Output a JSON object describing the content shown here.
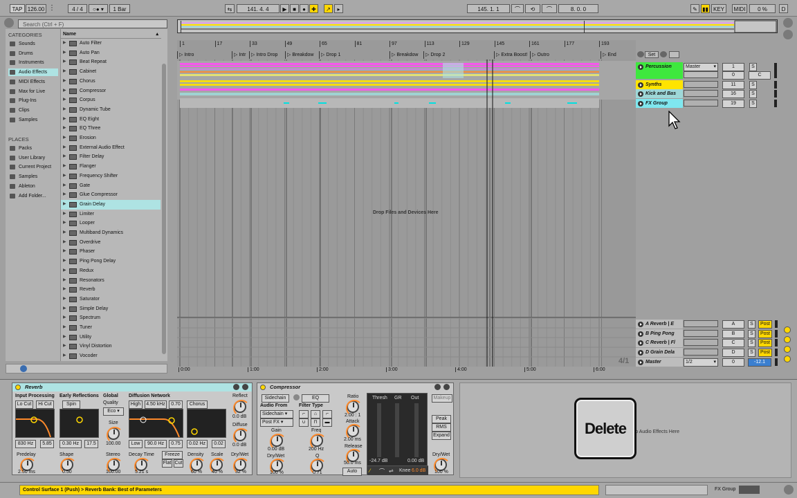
{
  "transport": {
    "tap": "TAP",
    "tempo": "126.00",
    "sig_num": "4",
    "sig_den": "4",
    "quantize": "1 Bar",
    "position": "141.  4.  4",
    "loop_start": "145.  1.  1",
    "loop_length": "8.  0.  0",
    "key_label": "KEY",
    "midi_label": "MIDI",
    "cpu": "0 %",
    "d_label": "D"
  },
  "browser": {
    "search_placeholder": "Search (Ctrl + F)",
    "categories_title": "CATEGORIES",
    "categories": [
      "Sounds",
      "Drums",
      "Instruments",
      "Audio Effects",
      "MIDI Effects",
      "Max for Live",
      "Plug-Ins",
      "Clips",
      "Samples"
    ],
    "selected_category": "Audio Effects",
    "places_title": "PLACES",
    "places": [
      "Packs",
      "User Library",
      "Current Project",
      "Samples",
      "Ableton",
      "Add Folder..."
    ],
    "name_header": "Name",
    "items": [
      "Auto Filter",
      "Auto Pan",
      "Beat Repeat",
      "Cabinet",
      "Chorus",
      "Compressor",
      "Corpus",
      "Dynamic Tube",
      "EQ Eight",
      "EQ Three",
      "Erosion",
      "External Audio Effect",
      "Filter Delay",
      "Flanger",
      "Frequency Shifter",
      "Gate",
      "Glue Compressor",
      "Grain Delay",
      "Limiter",
      "Looper",
      "Multiband Dynamics",
      "Overdrive",
      "Phaser",
      "Ping Pong Delay",
      "Redux",
      "Resonators",
      "Reverb",
      "Saturator",
      "Simple Delay",
      "Spectrum",
      "Tuner",
      "Utility",
      "Vinyl Distortion",
      "Vocoder"
    ],
    "selected_item": "Grain Delay"
  },
  "arrangement": {
    "bar_numbers": [
      "1",
      "17",
      "33",
      "49",
      "65",
      "81",
      "97",
      "113",
      "129",
      "145",
      "161",
      "177",
      "193"
    ],
    "locators": [
      "Intro",
      "Intr",
      "Intro Drop",
      "Breakdow",
      "Drop 1",
      "Breakdow",
      "Drop 2",
      "Extra Boost!",
      "Outro",
      "End"
    ],
    "time_labels": [
      "0:00",
      "1:00",
      "2:00",
      "3:00",
      "4:00",
      "5:00",
      "6:00"
    ],
    "drop_text": "Drop Files and Devices Here",
    "zoom_label": "4/1",
    "set_label": "Set"
  },
  "tracks": [
    {
      "name": "Percussion",
      "color": "#3ee83e",
      "routing": "Master",
      "number": "1",
      "value": "0",
      "solo": "S",
      "center": "C"
    },
    {
      "name": "Synths",
      "color": "#ffe400",
      "number": "11",
      "solo": "S"
    },
    {
      "name": "Kick and Bas",
      "color": "#9ed8d8",
      "number": "16",
      "solo": "S"
    },
    {
      "name": "FX Group",
      "color": "#7fe7ef",
      "number": "19",
      "solo": "S"
    }
  ],
  "returns": [
    {
      "name": "A Reverb | E",
      "letter": "A",
      "solo": "S",
      "post": "Post"
    },
    {
      "name": "B Ping Pong",
      "letter": "B",
      "solo": "S",
      "post": "Post"
    },
    {
      "name": "C Reverb | Fl",
      "letter": "C",
      "solo": "S",
      "post": "Post"
    },
    {
      "name": "D Grain Dela",
      "letter": "D",
      "solo": "S",
      "post": "Post"
    }
  ],
  "master": {
    "name": "Master",
    "routing": "1/2",
    "value": "0",
    "vol": "-12.1",
    "solo": "S"
  },
  "reverb": {
    "title": "Reverb",
    "input_processing": "Input Processing",
    "lo_cut": "Lo Cut",
    "hi_cut": "Hi Cut",
    "early_reflections": "Early Reflections",
    "spin": "Spin",
    "global": "Global",
    "quality": "Quality",
    "quality_val": "Eco",
    "size": "Size",
    "size_val": "100.00",
    "diffusion_network": "Diffusion Network",
    "high": "High",
    "high_freq": "4.50 kHz",
    "high_val": "0.70",
    "chorus": "Chorus",
    "reflect": "Reflect",
    "reflect_val": "0.0 dB",
    "diffuse": "Diffuse",
    "diffuse_val": "0.0 dB",
    "in_low": "830 Hz",
    "in_q": "5.85",
    "er_amt": "0.30 Hz",
    "er_shape": "17.5",
    "stereo": "Stereo",
    "stereo_val": "100.00",
    "low": "Low",
    "low_freq": "90.0 Hz",
    "low_val": "0.75",
    "ch_rate": "0.02 Hz",
    "ch_amt": "0.02",
    "predelay": "Predelay",
    "predelay_val": "2.50 ms",
    "shape": "Shape",
    "shape_val": "0.50",
    "decay": "Decay Time",
    "decay_val": "5.21 s",
    "freeze": "Freeze",
    "flat": "Flat",
    "cut": "Cut",
    "density": "Density",
    "density_val": "60 %",
    "scale": "Scale",
    "scale_val": "40 %",
    "drywet": "Dry/Wet",
    "drywet_val": "32 %"
  },
  "compressor": {
    "title": "Compressor",
    "sidechain": "Sidechain",
    "eq": "EQ",
    "audio_from": "Audio From",
    "source": "Sidechain",
    "tap": "Post FX",
    "gain": "Gain",
    "gain_val": "0.00 dB",
    "drywet": "Dry/Wet",
    "drywet_val": "100 %",
    "filter_type": "Filter Type",
    "freq": "Freq",
    "freq_val": "200 Hz",
    "q": "Q",
    "q_val": "0.71",
    "ratio": "Ratio",
    "ratio_val": "2.00 : 1",
    "attack": "Attack",
    "attack_val": "2.00 ms",
    "release": "Release",
    "release_val": "50.0 ms",
    "auto": "Auto",
    "thresh": "Thresh",
    "gr": "GR",
    "out": "Out",
    "thresh_val": "-24.7 dB",
    "out_val": "0.00 dB",
    "knee": "Knee",
    "knee_val": "6.0 dB",
    "makeup": "Makeup",
    "peak": "Peak",
    "rms": "RMS",
    "expand": "Expand",
    "drywet2": "Dry/Wet",
    "drywet2_val": "100 %"
  },
  "drop_zone": {
    "text": "Drop Audio Effects Here"
  },
  "delete_overlay": {
    "text": "Delete"
  },
  "status": {
    "message": "Control Surface 1 (Push) > Reverb Bank: Best of Parameters",
    "track": "FX Group"
  },
  "colors": {
    "accent": "#ffd700",
    "orange": "#ff8a2b",
    "selection": "#aee3e3"
  }
}
